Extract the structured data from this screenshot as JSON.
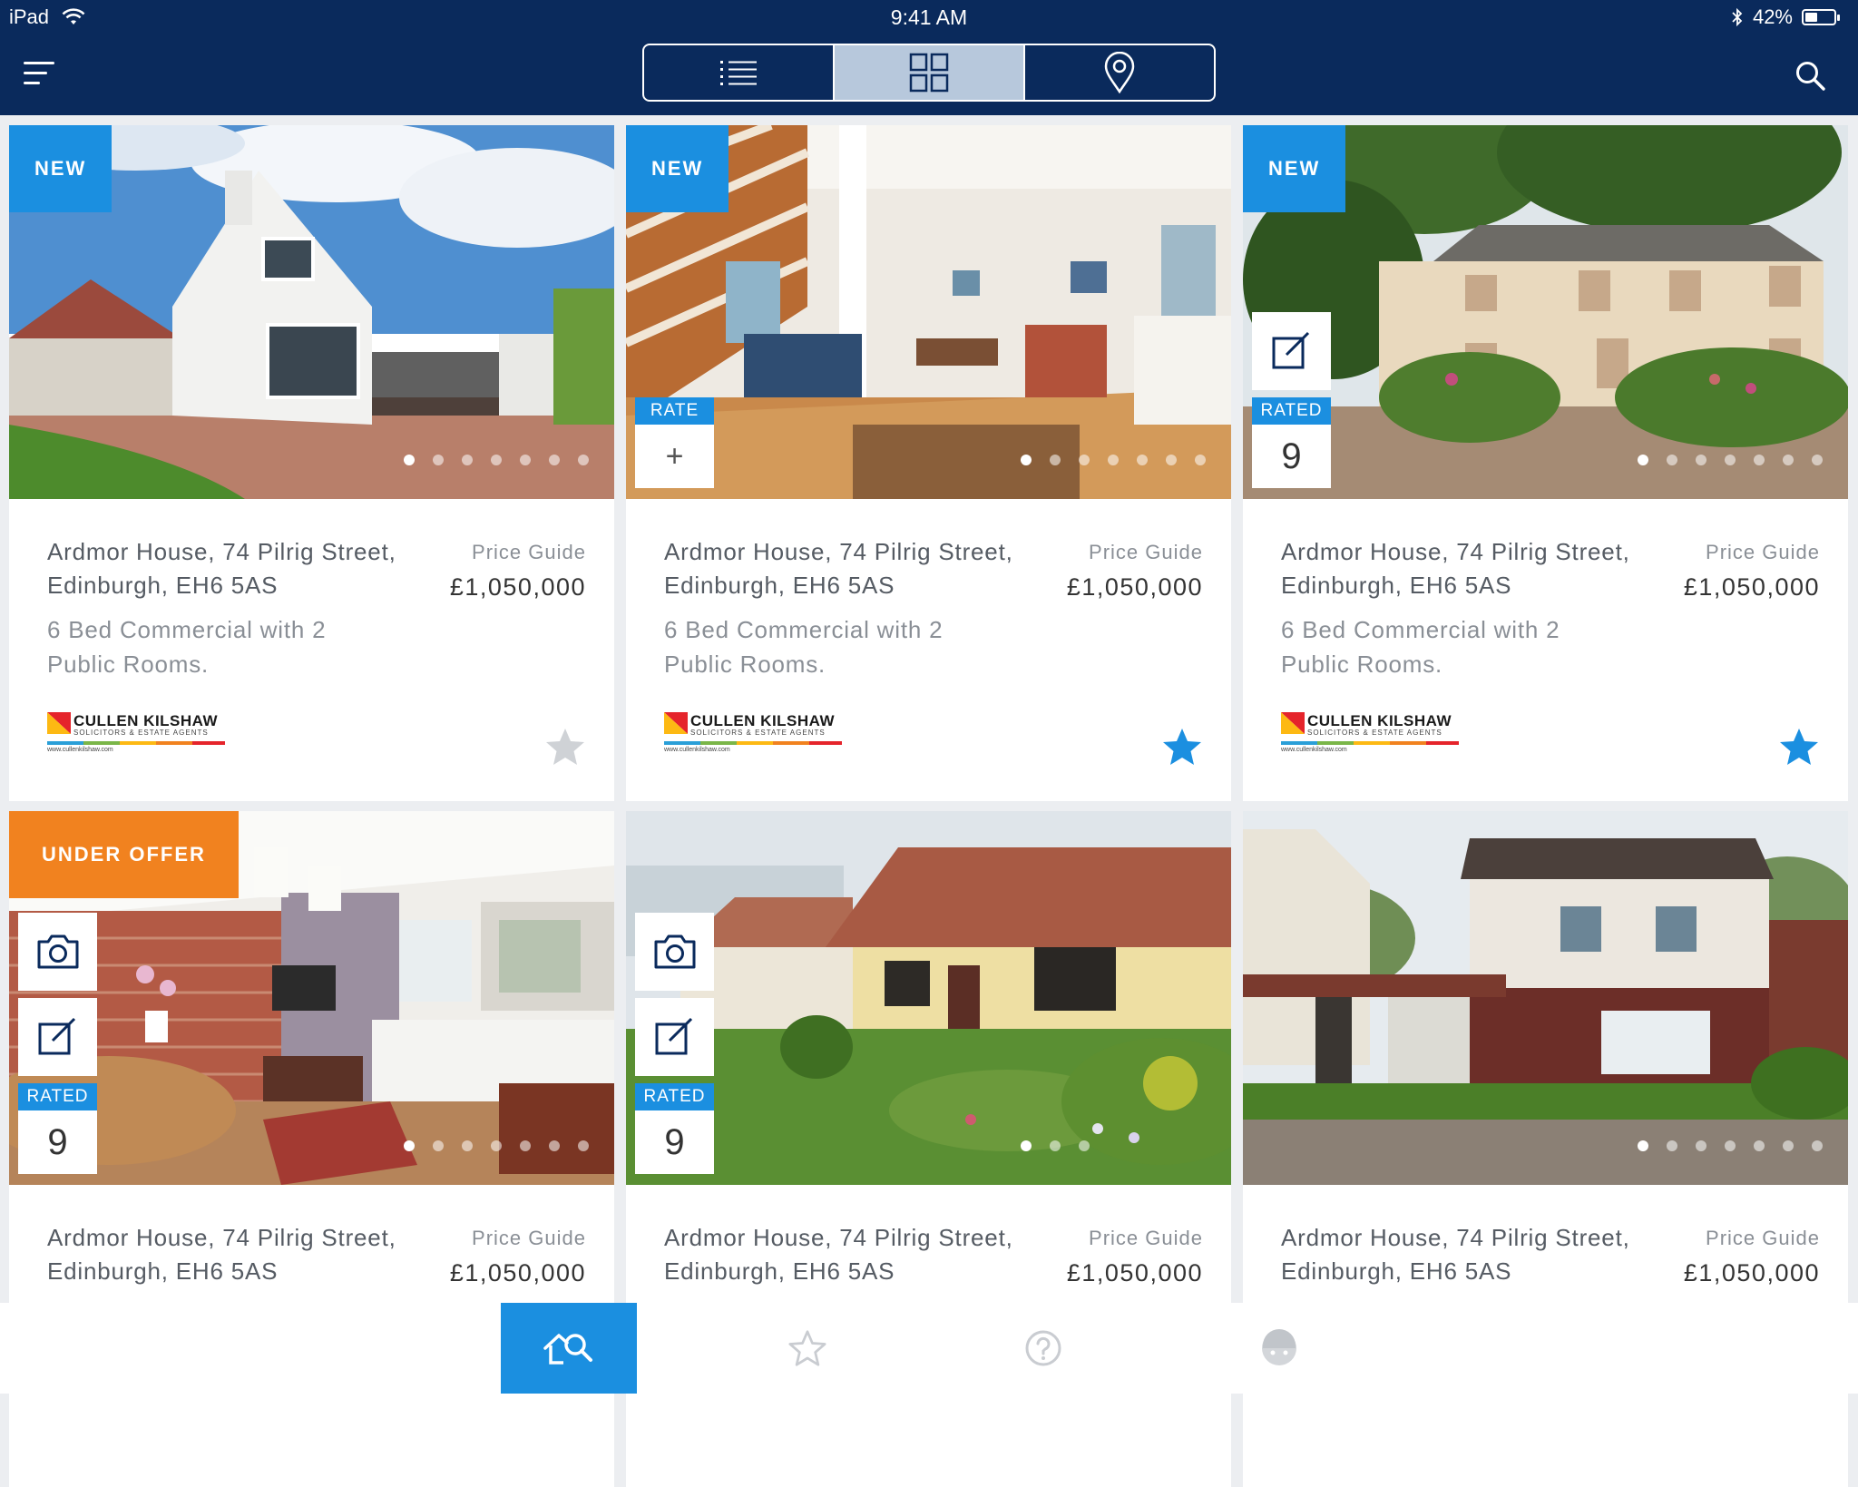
{
  "status_bar": {
    "device": "iPad",
    "time": "9:41 AM",
    "battery": "42%",
    "battery_level": 0.42
  },
  "header": {
    "menu_icon": "hamburger-icon",
    "search_icon": "search-icon",
    "view_modes": [
      {
        "icon": "list-icon",
        "active": false
      },
      {
        "icon": "grid-icon",
        "active": true
      },
      {
        "icon": "map-pin-icon",
        "active": false
      }
    ]
  },
  "colors": {
    "navy": "#0a2a5c",
    "accent_blue": "#1b8fe0",
    "offer_orange": "#f1821f",
    "segment_active": "#b7c8dc",
    "star_inactive": "#cfd2d6"
  },
  "listings": [
    {
      "badge": "NEW",
      "badge_type": "new",
      "address": "Ardmor House, 74 Pilrig Street, Edinburgh, EH6 5AS",
      "description": "6 Bed Commercial with 2 Public Rooms.",
      "price_label": "Price Guide",
      "price": "£1,050,000",
      "agent": {
        "name": "CULLEN KILSHAW",
        "tagline": "SOLICITORS & ESTATE AGENTS",
        "url": "www.cullenkilshaw.com"
      },
      "favourite": false,
      "image_count": 7,
      "image_index": 0
    },
    {
      "badge": "NEW",
      "badge_type": "new",
      "rate_label": "RATE",
      "rate_action": "+",
      "address": "Ardmor House, 74 Pilrig Street, Edinburgh, EH6 5AS",
      "description": "6 Bed Commercial with 2 Public Rooms.",
      "price_label": "Price Guide",
      "price": "£1,050,000",
      "agent": {
        "name": "CULLEN KILSHAW",
        "tagline": "SOLICITORS & ESTATE AGENTS",
        "url": "www.cullenkilshaw.com"
      },
      "favourite": true,
      "image_count": 7,
      "image_index": 0
    },
    {
      "badge": "NEW",
      "badge_type": "new",
      "has_note": true,
      "rated_label": "RATED",
      "rating": "9",
      "address": "Ardmor House, 74 Pilrig Street, Edinburgh, EH6 5AS",
      "description": "6 Bed Commercial with 2 Public Rooms.",
      "price_label": "Price Guide",
      "price": "£1,050,000",
      "agent": {
        "name": "CULLEN KILSHAW",
        "tagline": "SOLICITORS & ESTATE AGENTS",
        "url": "www.cullenkilshaw.com"
      },
      "favourite": true,
      "image_count": 7,
      "image_index": 0
    },
    {
      "badge": "UNDER OFFER",
      "badge_type": "offer",
      "has_photo": true,
      "has_note": true,
      "rated_label": "RATED",
      "rating": "9",
      "address": "Ardmor House, 74 Pilrig Street, Edinburgh, EH6 5AS",
      "price_label": "Price Guide",
      "price": "£1,050,000",
      "image_count": 7,
      "image_index": 0
    },
    {
      "has_photo": true,
      "has_note": true,
      "rated_label": "RATED",
      "rating": "9",
      "address": "Ardmor House, 74 Pilrig Street, Edinburgh, EH6 5AS",
      "price_label": "Price Guide",
      "price": "£1,050,000",
      "image_count": 3,
      "image_index": 0
    },
    {
      "address": "Ardmor House, 74 Pilrig Street, Edinburgh, EH6 5AS",
      "price_label": "Price Guide",
      "price": "£1,050,000",
      "image_count": 7,
      "image_index": 0
    }
  ],
  "tab_bar": [
    {
      "icon": "home-search-icon",
      "active": true
    },
    {
      "icon": "star-outline-icon",
      "active": false
    },
    {
      "icon": "help-circle-icon",
      "active": false
    },
    {
      "icon": "profile-icon",
      "active": false
    }
  ]
}
